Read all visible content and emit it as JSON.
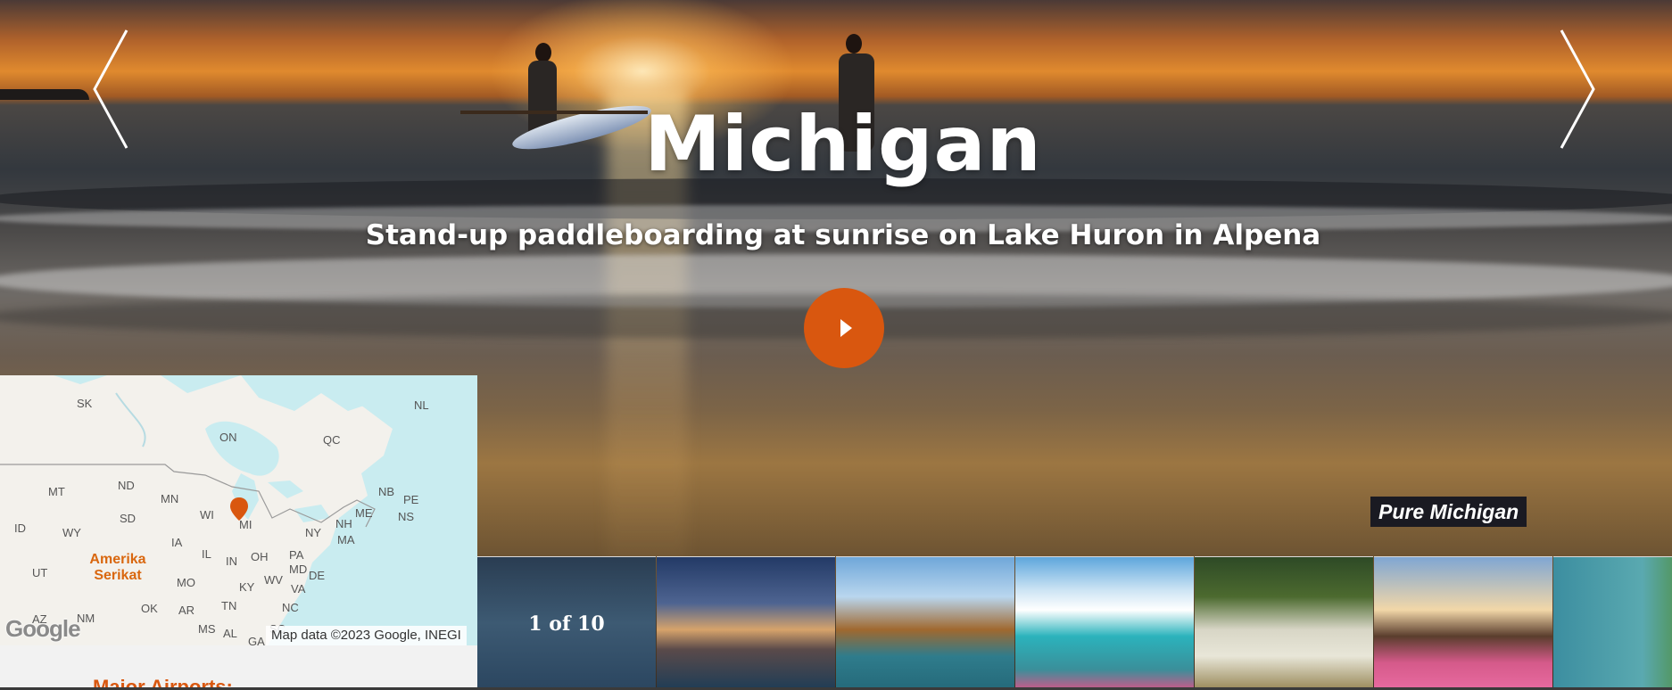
{
  "hero": {
    "title": "Michigan",
    "subtitle": "Stand-up paddleboarding at sunrise on Lake Huron in Alpena",
    "photo_credit": "Pure Michigan",
    "play_icon": "play-icon",
    "prev_icon": "chevron-left-icon",
    "next_icon": "chevron-right-icon",
    "accent_color": "#d9570f"
  },
  "map": {
    "labels": [
      "SK",
      "NL",
      "ON",
      "QC",
      "ND",
      "MT",
      "MN",
      "NB",
      "PE",
      "NS",
      "ME",
      "ID",
      "SD",
      "WY",
      "WI",
      "MI",
      "NY",
      "NH",
      "MA",
      "IA",
      "IL",
      "IN",
      "OH",
      "PA",
      "MD",
      "DE",
      "UT",
      "MO",
      "KY",
      "WV",
      "VA",
      "OK",
      "AR",
      "TN",
      "NC",
      "AZ",
      "NM",
      "MS",
      "AL",
      "GA",
      "SC"
    ],
    "country_label": "Amerika Serikat",
    "attribution": "Map data ©2023 Google, INEGI",
    "logo_text": "Google",
    "pin_icon": "map-pin-icon"
  },
  "airports": {
    "heading": "Major Airports:"
  },
  "gallery": {
    "counter": "1 of 10",
    "thumbnails": [
      "Sunrise paddleboard scene",
      "Detroit skyline at dusk",
      "Turnip Rock kayak",
      "Mackinac Island ferry dock",
      "Tahquamenon Falls",
      "Holland windmill and tulips",
      "Lake shoreline greenery"
    ]
  }
}
